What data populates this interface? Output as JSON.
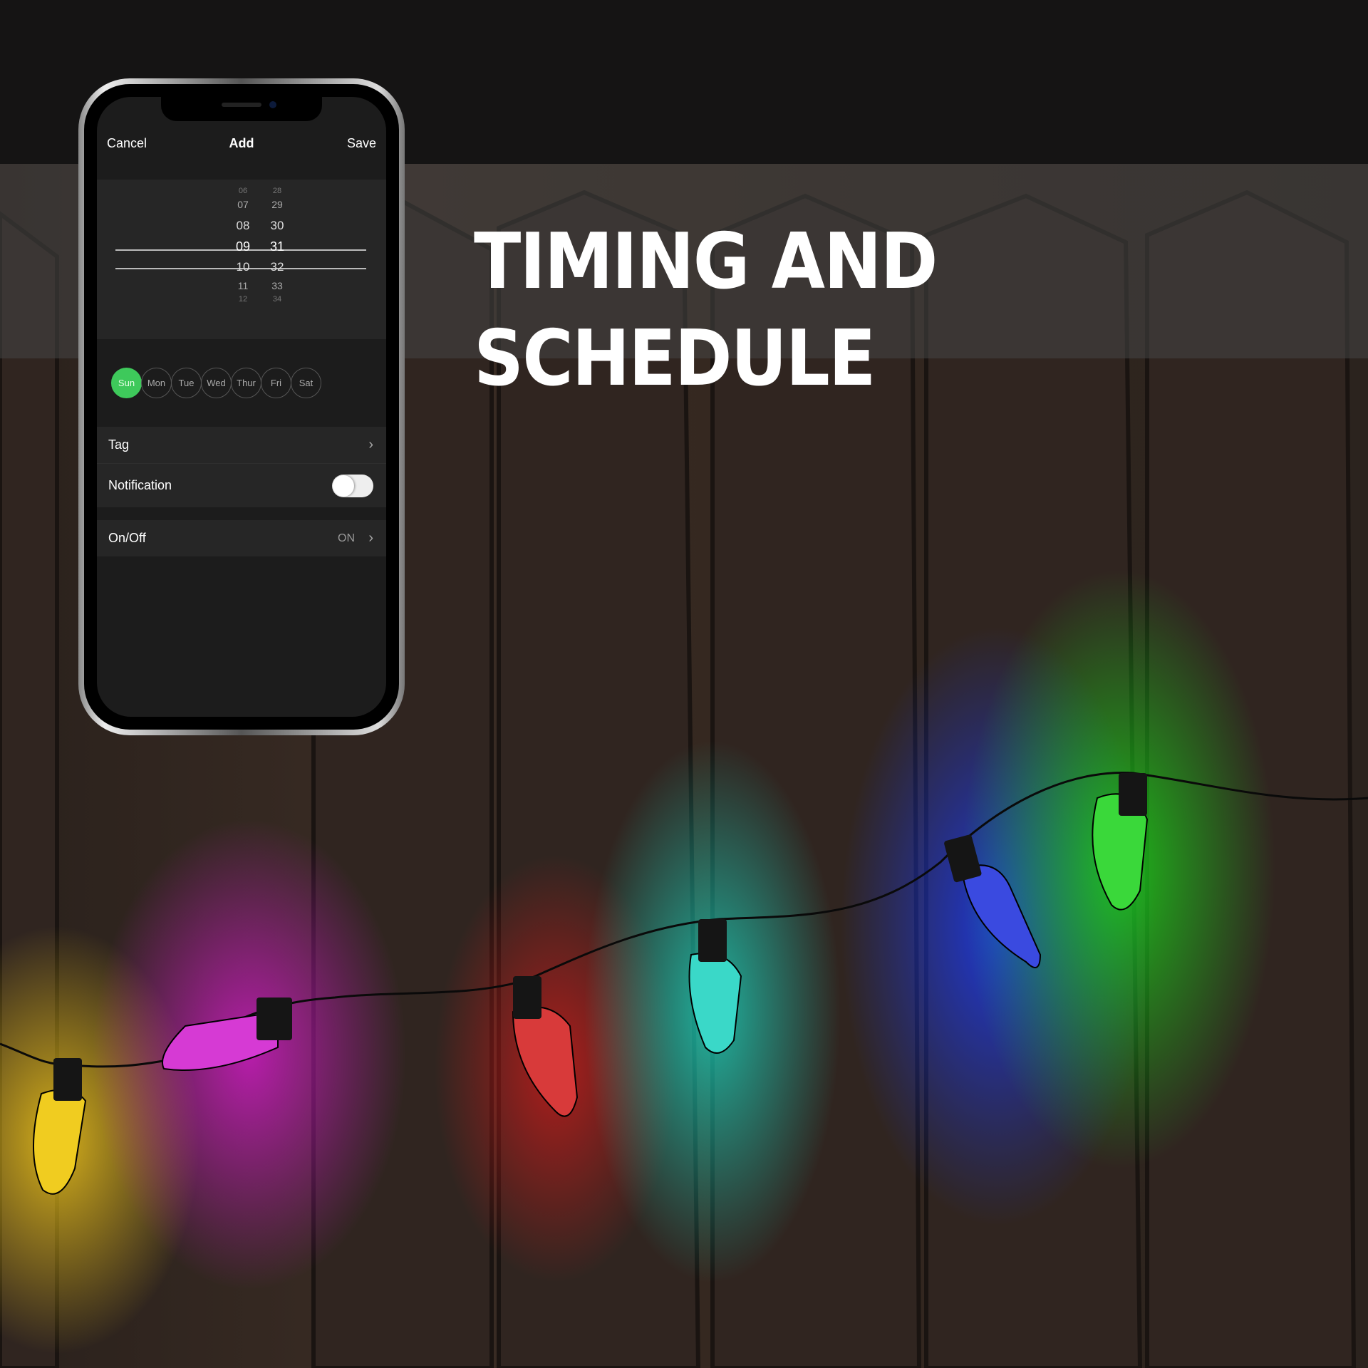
{
  "banner": {
    "title": "TIMING AND SCHEDULE"
  },
  "app": {
    "nav": {
      "cancel": "Cancel",
      "title": "Add",
      "save": "Save"
    },
    "picker": {
      "hours": [
        "06",
        "07",
        "08",
        "09",
        "10",
        "11",
        "12"
      ],
      "minutes": [
        "28",
        "29",
        "30",
        "31",
        "32",
        "33",
        "34"
      ],
      "selected_hour": "09",
      "selected_minute": "31"
    },
    "days": [
      {
        "label": "Sun",
        "selected": true
      },
      {
        "label": "Mon",
        "selected": false
      },
      {
        "label": "Tue",
        "selected": false
      },
      {
        "label": "Wed",
        "selected": false
      },
      {
        "label": "Thur",
        "selected": false
      },
      {
        "label": "Fri",
        "selected": false
      },
      {
        "label": "Sat",
        "selected": false
      }
    ],
    "tag": {
      "label": "Tag"
    },
    "notification": {
      "label": "Notification",
      "enabled": false
    },
    "onoff": {
      "label": "On/Off",
      "value": "ON"
    },
    "accent": "#3ec95b"
  }
}
